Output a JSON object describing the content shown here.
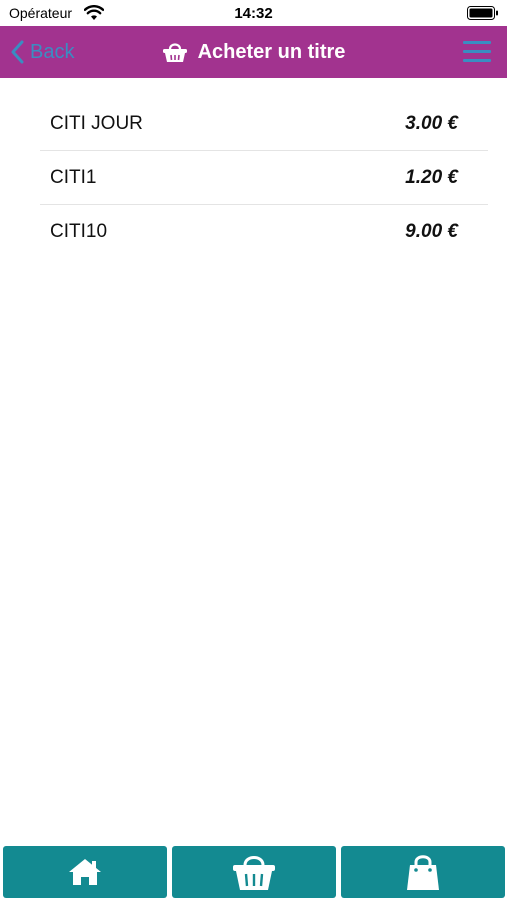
{
  "status_bar": {
    "carrier": "Opérateur",
    "time": "14:32",
    "wifi_icon": "wifi-icon",
    "battery_icon": "battery-icon"
  },
  "nav": {
    "back_label": "Back",
    "title": "Acheter un titre",
    "title_icon": "basket-icon",
    "menu_icon": "hamburger-menu-icon",
    "background_color": "#a2338f",
    "accent_color": "#3a8dc2"
  },
  "products": [
    {
      "name": "CITI JOUR",
      "price": "3.00 €"
    },
    {
      "name": "CITI1",
      "price": "1.20 €"
    },
    {
      "name": "CITI10",
      "price": "9.00 €"
    }
  ],
  "tab_bar": {
    "color": "#138a91",
    "tabs": [
      {
        "icon": "home-icon"
      },
      {
        "icon": "basket-icon"
      },
      {
        "icon": "shopping-bag-icon"
      }
    ]
  }
}
